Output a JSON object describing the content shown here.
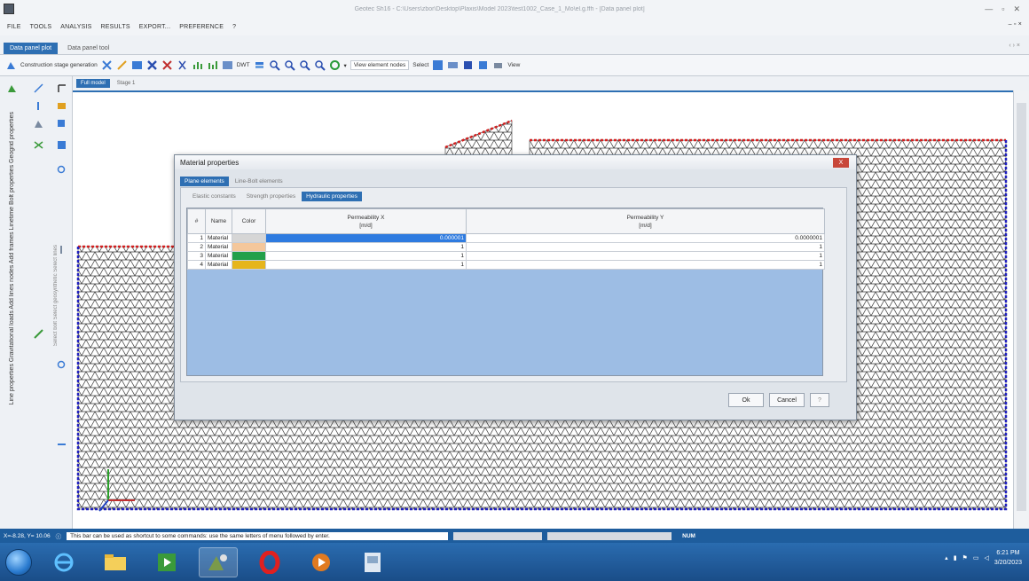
{
  "app": {
    "title": "Geotec Sh16 - C:\\Users\\zbor\\Desktop\\Plaxis\\Model 2023\\test1002_Case_1_Mo\\el.g.ffh - [Data panel plot]",
    "window_controls": [
      "—",
      "▫",
      "✕"
    ],
    "mdi_controls": "– ▫ ×"
  },
  "menu": [
    "FILE",
    "TOOLS",
    "ANALYSIS",
    "RESULTS",
    "EXPORT...",
    "PREFERENCE",
    "?"
  ],
  "tabs": [
    {
      "label": "Data panel plot",
      "active": true
    },
    {
      "label": "Data panel tool",
      "active": false
    }
  ],
  "tab_arrows": "‹ › ×",
  "toolbar": {
    "stage_label": "Construction stage generation",
    "dwt_label": "DWT",
    "view_nodes": "View element nodes",
    "select_label": "Select",
    "view_label": "View"
  },
  "left_panel": {
    "vertical_text": "Line properties  Gravitational loads  Add lines nodes  Add frames  Linetime  Bolt properties  Geogrid properties",
    "vertical_text_2": "Select bolt   Select geosynthetic   Select lines"
  },
  "view_tabs": [
    {
      "label": "Full model",
      "active": true
    },
    {
      "label": "Stage 1",
      "active": false
    }
  ],
  "dialog": {
    "title": "Material properties",
    "close": "X",
    "top_tabs": [
      {
        "label": "Plane elements",
        "active": true
      },
      {
        "label": "Line-Bolt elements",
        "active": false
      }
    ],
    "sub_tabs": [
      {
        "label": "Elastic constants",
        "active": false
      },
      {
        "label": "Strength properties",
        "active": false
      },
      {
        "label": "Hydraulic properties",
        "active": true
      }
    ],
    "columns": [
      "#",
      "Name",
      "Color",
      "Permeability X [m/d]",
      "Permeability Y [m/d]"
    ],
    "col_hash": "#",
    "col_name": "Name",
    "col_color": "Color",
    "col_px": "Permeability X",
    "col_px_unit": "[m/d]",
    "col_py": "Permeability Y",
    "col_py_unit": "[m/d]",
    "rows": [
      {
        "n": "1",
        "name": "Material",
        "color": "#d6d6d6",
        "px": "0.000001",
        "py": "0.0000001"
      },
      {
        "n": "2",
        "name": "Material",
        "color": "#f4c79b",
        "px": "1",
        "py": "1"
      },
      {
        "n": "3",
        "name": "Material",
        "color": "#22a04a",
        "px": "1",
        "py": "1"
      },
      {
        "n": "4",
        "name": "Material",
        "color": "#e6b51c",
        "px": "1",
        "py": "1"
      }
    ],
    "buttons": {
      "ok": "Ok",
      "cancel": "Cancel",
      "help": "?"
    }
  },
  "status": {
    "coords": "X=-8.28, Y= 10.06",
    "help_text": "This bar can be used as shortcut to some commands: use the same letters of menu followed by enter.",
    "mode": "NUM"
  },
  "taskbar": {
    "time": "6:21 PM",
    "date": "3/20/2023"
  },
  "colors": {
    "accent": "#2e6fb3",
    "mesh": "#3a3a3a",
    "boundary_top": "#d42020",
    "boundary_fixed": "#2020c0"
  }
}
